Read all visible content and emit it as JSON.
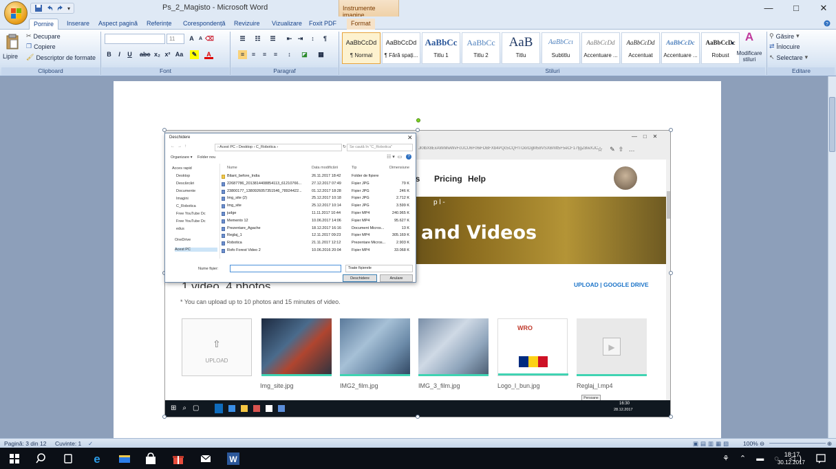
{
  "window": {
    "title": "Ps_2_Magisto - Microsoft Word",
    "context_tools": "Instrumente imagine",
    "minimize": "—",
    "maximize": "□",
    "close": "✕"
  },
  "tabs": [
    "Pornire",
    "Inserare",
    "Aspect pagină",
    "Referințe",
    "Corespondență",
    "Revizuire",
    "Vizualizare",
    "Foxit PDF",
    "Format"
  ],
  "ribbon": {
    "clipboard": {
      "paste": "Lipire",
      "cut": "Decupare",
      "copy": "Copiere",
      "format_painter": "Descriptor de formate",
      "label": "Clipboard"
    },
    "font": {
      "size": "11",
      "label": "Font"
    },
    "paragraph": {
      "label": "Paragraf"
    },
    "styles": {
      "label": "Stiluri",
      "items": [
        {
          "preview": "AaBbCcDd",
          "name": "¶ Normal"
        },
        {
          "preview": "AaBbCcDd",
          "name": "¶ Fără spați..."
        },
        {
          "preview": "AaBbCc",
          "name": "Titlu 1"
        },
        {
          "preview": "AaBbCc",
          "name": "Titlu 2"
        },
        {
          "preview": "AaB",
          "name": "Titlu"
        },
        {
          "preview": "AaBbCcı",
          "name": "Subtitlu"
        },
        {
          "preview": "AaBbCcDd",
          "name": "Accentuare ..."
        },
        {
          "preview": "AaBbCcDd",
          "name": "Accentuat"
        },
        {
          "preview": "AaBbCcDc",
          "name": "Accentuare ..."
        },
        {
          "preview": "AaBbCcDc",
          "name": "Robust"
        }
      ],
      "change": "Modificare stiluri"
    },
    "editing": {
      "label": "Editare",
      "find": "Găsire",
      "replace": "Înlocuire",
      "select": "Selectare"
    }
  },
  "embedded": {
    "address": "Jl0lbX8ExAWiMwWvFcUCU6F06iFDBFXb4PQc5CQFfTOorDgM58VSXBmtt5F5eCF17fjgZBwXJC",
    "nav": [
      "ss",
      "Pricing",
      "Help"
    ],
    "hero_sub": "p l -",
    "hero_text": "and Videos",
    "videos_count": "1 video, 4 photos",
    "upload_note": "* You can upload up to 10 photos and 15 minutes of video.",
    "upload_links": "UPLOAD  |  GOOGLE DRIVE",
    "upload_box": "UPLOAD",
    "thumbs": [
      "Img_site.jpg",
      "IMG2_film.jpg",
      "IMG_3_film.jpg",
      "Logo_l_bun.jpg",
      "Reglaj_l.mp4"
    ],
    "tooltip": "Persoane",
    "clock_time": "16:30",
    "clock_date": "28.12.2017"
  },
  "dialog": {
    "title": "Deschidere",
    "close": "✕",
    "path": "›  Acest PC  ›  Desktop  ›  C_Robotica  ›",
    "search_placeholder": "Se caută în \"C_Robotica\"",
    "organize": "Organizare ▾",
    "new_folder": "Folder nou",
    "sidebar": [
      "Acces rapid",
      "Desktop",
      "Descărcări",
      "Documente",
      "Imagini",
      "C_Robotica",
      "Free YouTube Dc",
      "Free YouTube Dc",
      "edus",
      "OneDrive",
      "Acest PC"
    ],
    "columns": [
      "Nume",
      "Data modificării",
      "Tip",
      "Dimensiune"
    ],
    "files": [
      {
        "name": "Bilant_before_India",
        "date": "26.11.2017 18:42",
        "type": "Folder de fișiere",
        "size": ""
      },
      {
        "name": "22687786_2013814408854113_61210766...",
        "date": "27.12.2017 07:49",
        "type": "Fișier JPG",
        "size": "79 K"
      },
      {
        "name": "23800177_1380926057351546_78924422...",
        "date": "01.12.2017 18:28",
        "type": "Fișier JPG",
        "size": "246 K"
      },
      {
        "name": "Img_site (2)",
        "date": "25.12.2017 10:18",
        "type": "Fișier JPG",
        "size": "2.712 K"
      },
      {
        "name": "Img_site",
        "date": "25.12.2017 10:14",
        "type": "Fișier JPG",
        "size": "3.599 K"
      },
      {
        "name": "judge",
        "date": "11.11.2017 10:44",
        "type": "Fișier MP4",
        "size": "240.965 K"
      },
      {
        "name": "Memento 12",
        "date": "10.06.2017 14:06",
        "type": "Fișier MP4",
        "size": "95.627 K"
      },
      {
        "name": "Prezentare_Agache",
        "date": "18.12.2017 16:16",
        "type": "Document Micros...",
        "size": "13 K"
      },
      {
        "name": "Reglaj_1",
        "date": "12.11.2017 09:23",
        "type": "Fișier MP4",
        "size": "305.169 K"
      },
      {
        "name": "Robotica",
        "date": "21.11.2017 12:12",
        "type": "Prezentare Micros...",
        "size": "2.903 K"
      },
      {
        "name": "Rofo Forest Video 2",
        "date": "10.06.2016 20:04",
        "type": "Fișier MP4",
        "size": "33.068 K"
      }
    ],
    "filename_label": "Nume fișier:",
    "filter": "Toate fișierele",
    "open": "Deschidere",
    "cancel": "Anulare"
  },
  "status": {
    "page": "Pagină: 3 din 12",
    "words": "Cuvinte: 1",
    "zoom": "100%"
  },
  "taskbar": {
    "time": "18:17",
    "date": "30.12.2017"
  },
  "colors": {
    "accent": "#2b579a",
    "teal": "#3fd3b2",
    "link": "#1a73c8"
  }
}
